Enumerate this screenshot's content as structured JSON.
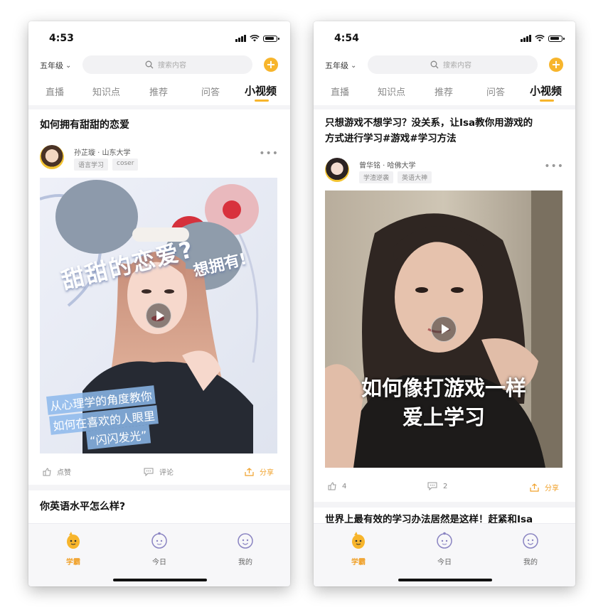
{
  "phones": [
    {
      "status": {
        "time": "4:53"
      },
      "header": {
        "grade": "五年级",
        "search_placeholder": "搜索内容"
      },
      "tabs": [
        "直播",
        "知识点",
        "推荐",
        "问答",
        "小视频"
      ],
      "active_tab": "小视频",
      "post": {
        "title": "如何拥有甜甜的恋爱",
        "author": "孙芷璇 · 山东大学",
        "tags": [
          "语言学习",
          "coser"
        ],
        "video_overlay": {
          "line1": "甜甜的恋爱?",
          "line2": "想拥有!",
          "line3": "从心理学的角度教你",
          "line4": "如何在喜欢的人眼里",
          "line5": "“闪闪发光”"
        },
        "like": "点赞",
        "comment": "评论",
        "share": "分享"
      },
      "next_post_title": "你英语水平怎么样?",
      "nav": [
        {
          "label": "学霸",
          "icon": "thumbs-up-mascot-icon"
        },
        {
          "label": "今日",
          "icon": "today-mascot-icon"
        },
        {
          "label": "我的",
          "icon": "profile-mascot-icon"
        }
      ]
    },
    {
      "status": {
        "time": "4:54"
      },
      "header": {
        "grade": "五年级",
        "search_placeholder": "搜索内容"
      },
      "tabs": [
        "直播",
        "知识点",
        "推荐",
        "问答",
        "小视频"
      ],
      "active_tab": "小视频",
      "post": {
        "title_line1": "只想游戏不想学习？没关系，让Isa教你用游戏的",
        "title_line2": "方式进行学习#游戏#学习方法",
        "author": "曾华铭 · 哈佛大学",
        "tags": [
          "学渣逆袭",
          "英语大神"
        ],
        "video_overlay": {
          "line1": "如何像打游戏一样",
          "line2": "爱上学习"
        },
        "like": "4",
        "comment": "2",
        "share": "分享"
      },
      "next_post_title": "世界上最有效的学习办法居然是这样！赶紧和Isa",
      "nav": [
        {
          "label": "学霸",
          "icon": "thumbs-up-mascot-icon"
        },
        {
          "label": "今日",
          "icon": "today-mascot-icon"
        },
        {
          "label": "我的",
          "icon": "profile-mascot-icon"
        }
      ]
    }
  ],
  "colors": {
    "accent": "#f7b52c",
    "accent_text": "#f0a12a",
    "background": "#f4f4f6"
  }
}
